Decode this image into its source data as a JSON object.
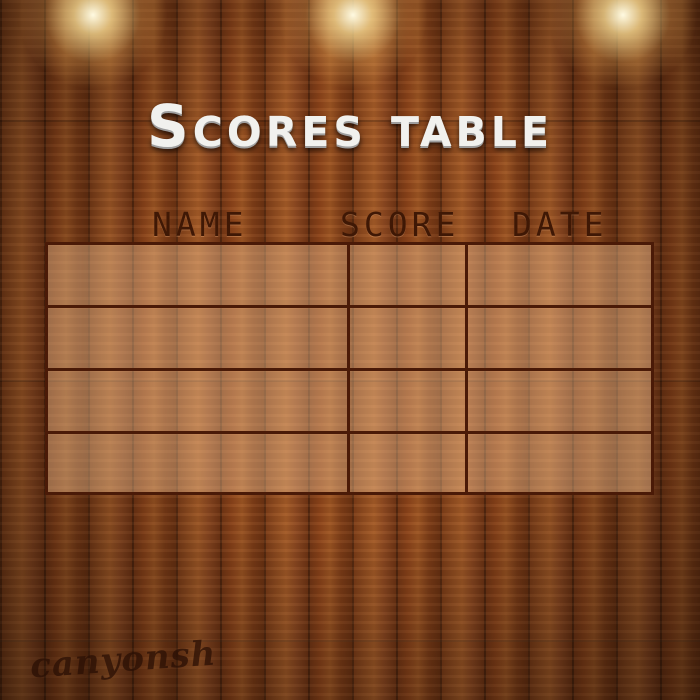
{
  "title": "Scores table",
  "headers": {
    "name": "NAME",
    "score": "SCORE",
    "date": "DATE"
  },
  "rows": [
    {
      "name": "",
      "score": "",
      "date": ""
    },
    {
      "name": "",
      "score": "",
      "date": ""
    },
    {
      "name": "",
      "score": "",
      "date": ""
    },
    {
      "name": "",
      "score": "",
      "date": ""
    }
  ],
  "signature": "canyonsh",
  "colors": {
    "wood": "#8f4b1f",
    "ink": "#3f1805",
    "title": "#f1f1ee"
  },
  "icons": [
    "spotlight",
    "spotlight",
    "spotlight"
  ]
}
